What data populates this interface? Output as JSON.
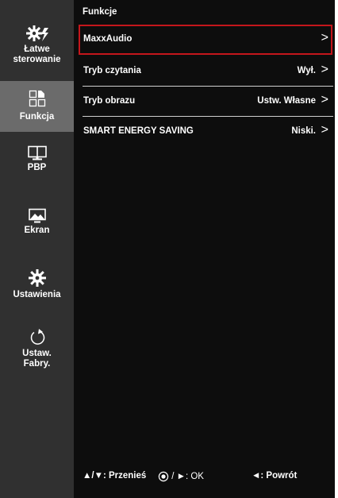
{
  "sidebar": {
    "items": [
      {
        "label": "Łatwe\nsterowanie",
        "icon": "easy-control-icon",
        "selected": false
      },
      {
        "label": "Funkcja",
        "icon": "function-icon",
        "selected": true
      },
      {
        "label": "PBP",
        "icon": "pbp-icon",
        "selected": false
      },
      {
        "label": "Ekran",
        "icon": "screen-icon",
        "selected": false
      },
      {
        "label": "Ustawienia",
        "icon": "settings-gear-icon",
        "selected": false
      },
      {
        "label": "Ustaw.\nFabry.",
        "icon": "factory-reset-icon",
        "selected": false
      }
    ]
  },
  "main": {
    "title": "Funkcje",
    "rows": [
      {
        "label": "MaxxAudio",
        "value": "",
        "arrow": ">",
        "highlighted": true
      },
      {
        "label": "Tryb czytania",
        "value": "Wył.",
        "arrow": ">",
        "highlighted": false
      },
      {
        "label": "Tryb obrazu",
        "value": "Ustw. Własne",
        "arrow": ">",
        "highlighted": false
      },
      {
        "label": "SMART ENERGY SAVING",
        "value": "Niski.",
        "arrow": ">",
        "highlighted": false
      }
    ]
  },
  "footer": {
    "move": "▲/▼: Przenieś",
    "ok": "/ ►: OK",
    "back": "◄: Powrót"
  },
  "colors": {
    "background": "#0d0d0d",
    "sidebar": "#303030",
    "sidebar_selected": "#6b6b6b",
    "highlight_border": "#c4161c",
    "text": "#ffffff"
  }
}
